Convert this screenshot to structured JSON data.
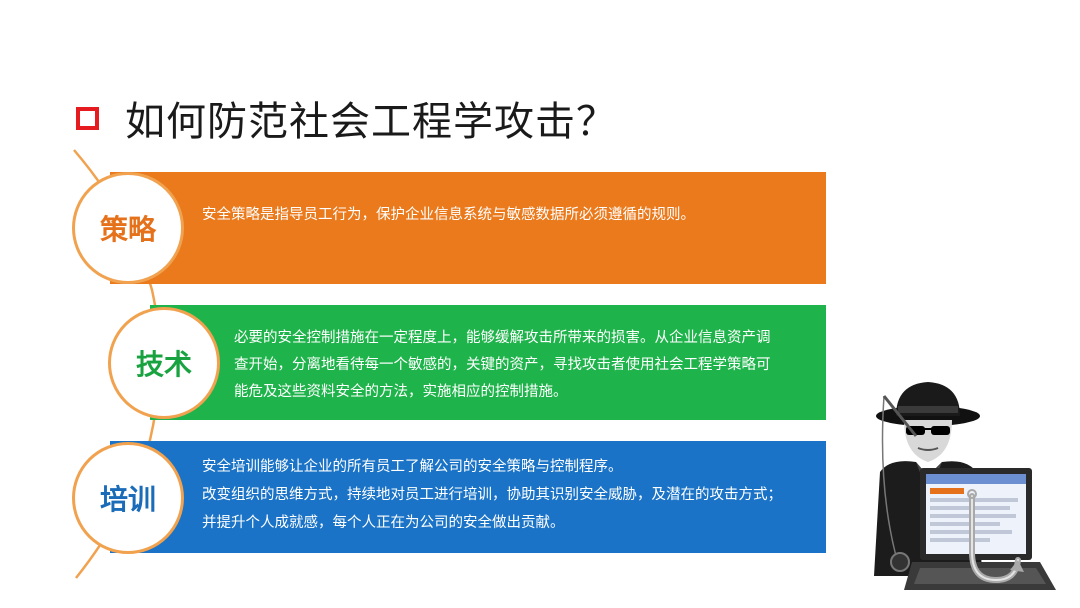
{
  "title": {
    "text": "如何防范社会工程学攻击？"
  },
  "items": [
    {
      "label": "策略",
      "lines": [
        "安全策略是指导员工行为，保护企业信息系统与敏感数据所必须遵循的规则。"
      ]
    },
    {
      "label": "技术",
      "lines": [
        "必要的安全控制措施在一定程度上，能够缓解攻击所带来的损害。从企业信息资产调",
        "查开始，分离地看待每一个敏感的，关键的资产，寻找攻击者使用社会工程学策略可",
        "能危及这些资料安全的方法，实施相应的控制措施。"
      ]
    },
    {
      "label": "培训",
      "lines": [
        "安全培训能够让企业的所有员工了解公司的安全策略与控制程序。",
        "改变组织的思维方式，持续地对员工进行培训，协助其识别安全威胁，及潜在的攻击方式；",
        "并提升个人成就感，每个人正在为公司的安全做出贡献。"
      ]
    }
  ],
  "colors": {
    "accent_red": "#e51b20",
    "orange": "#ea7a1c",
    "green": "#1fb44b",
    "blue": "#1a73c6",
    "arc": "#f1a24f"
  },
  "illustration": {
    "icon": "hacker-with-laptop-and-fishing-hook-icon"
  }
}
